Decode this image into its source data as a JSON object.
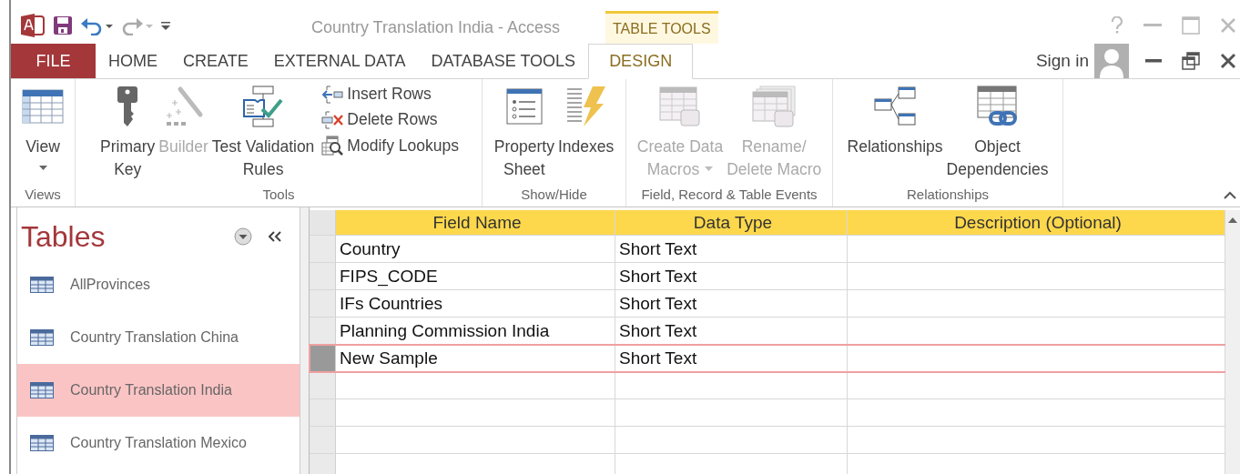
{
  "window": {
    "title": "Country Translation India - Access"
  },
  "contextual_group": {
    "label": "TABLE TOOLS"
  },
  "tabs": [
    {
      "label": "FILE",
      "kind": "file",
      "selected": false
    },
    {
      "label": "HOME",
      "kind": "tab",
      "selected": false
    },
    {
      "label": "CREATE",
      "kind": "tab",
      "selected": false
    },
    {
      "label": "EXTERNAL DATA",
      "kind": "tab",
      "selected": false
    },
    {
      "label": "DATABASE TOOLS",
      "kind": "tab",
      "selected": false
    },
    {
      "label": "DESIGN",
      "kind": "contextual",
      "selected": true
    }
  ],
  "account": {
    "label": "Sign in"
  },
  "ribbon": {
    "groups": [
      {
        "label": "Views",
        "items": [
          {
            "kind": "large",
            "lines": [
              "View"
            ],
            "dropdown": true,
            "disabled": false
          }
        ]
      },
      {
        "label": "Tools",
        "items": [
          {
            "kind": "large",
            "lines": [
              "Primary",
              "Key"
            ],
            "dropdown": false,
            "disabled": false
          },
          {
            "kind": "large",
            "lines": [
              "Builder"
            ],
            "dropdown": false,
            "disabled": true
          },
          {
            "kind": "large",
            "lines": [
              "Test Validation",
              "Rules"
            ],
            "dropdown": false,
            "disabled": false
          },
          {
            "kind": "small",
            "lines": [
              "Insert Rows"
            ],
            "dropdown": false,
            "disabled": false
          },
          {
            "kind": "small",
            "lines": [
              "Delete Rows"
            ],
            "dropdown": false,
            "disabled": false
          },
          {
            "kind": "small",
            "lines": [
              "Modify Lookups"
            ],
            "dropdown": false,
            "disabled": false
          }
        ]
      },
      {
        "label": "Show/Hide",
        "items": [
          {
            "kind": "large",
            "lines": [
              "Property",
              "Sheet"
            ],
            "dropdown": false,
            "disabled": false
          },
          {
            "kind": "large",
            "lines": [
              "Indexes"
            ],
            "dropdown": false,
            "disabled": false
          }
        ]
      },
      {
        "label": "Field, Record & Table Events",
        "items": [
          {
            "kind": "large",
            "lines": [
              "Create Data",
              "Macros"
            ],
            "dropdown": true,
            "disabled": true
          },
          {
            "kind": "large",
            "lines": [
              "Rename/",
              "Delete Macro"
            ],
            "dropdown": false,
            "disabled": true
          }
        ]
      },
      {
        "label": "Relationships",
        "items": [
          {
            "kind": "large",
            "lines": [
              "Relationships"
            ],
            "dropdown": false,
            "disabled": false
          },
          {
            "kind": "large",
            "lines": [
              "Object",
              "Dependencies"
            ],
            "dropdown": false,
            "disabled": false
          }
        ]
      }
    ]
  },
  "nav_pane": {
    "title": "Tables",
    "items": [
      {
        "label": "AllProvinces",
        "selected": false
      },
      {
        "label": "Country Translation China",
        "selected": false
      },
      {
        "label": "Country Translation India",
        "selected": true
      },
      {
        "label": "Country Translation Mexico",
        "selected": false
      }
    ]
  },
  "table": {
    "columns": [
      "Field Name",
      "Data Type",
      "Description (Optional)"
    ],
    "rows": [
      {
        "cells": [
          "Country",
          "Short Text",
          ""
        ],
        "selected": false
      },
      {
        "cells": [
          "FIPS_CODE",
          "Short Text",
          ""
        ],
        "selected": false
      },
      {
        "cells": [
          "IFs Countries",
          "Short Text",
          ""
        ],
        "selected": false
      },
      {
        "cells": [
          "Planning Commission India",
          "Short Text",
          ""
        ],
        "selected": false
      },
      {
        "cells": [
          "New Sample",
          "Short Text",
          ""
        ],
        "selected": true
      }
    ]
  }
}
